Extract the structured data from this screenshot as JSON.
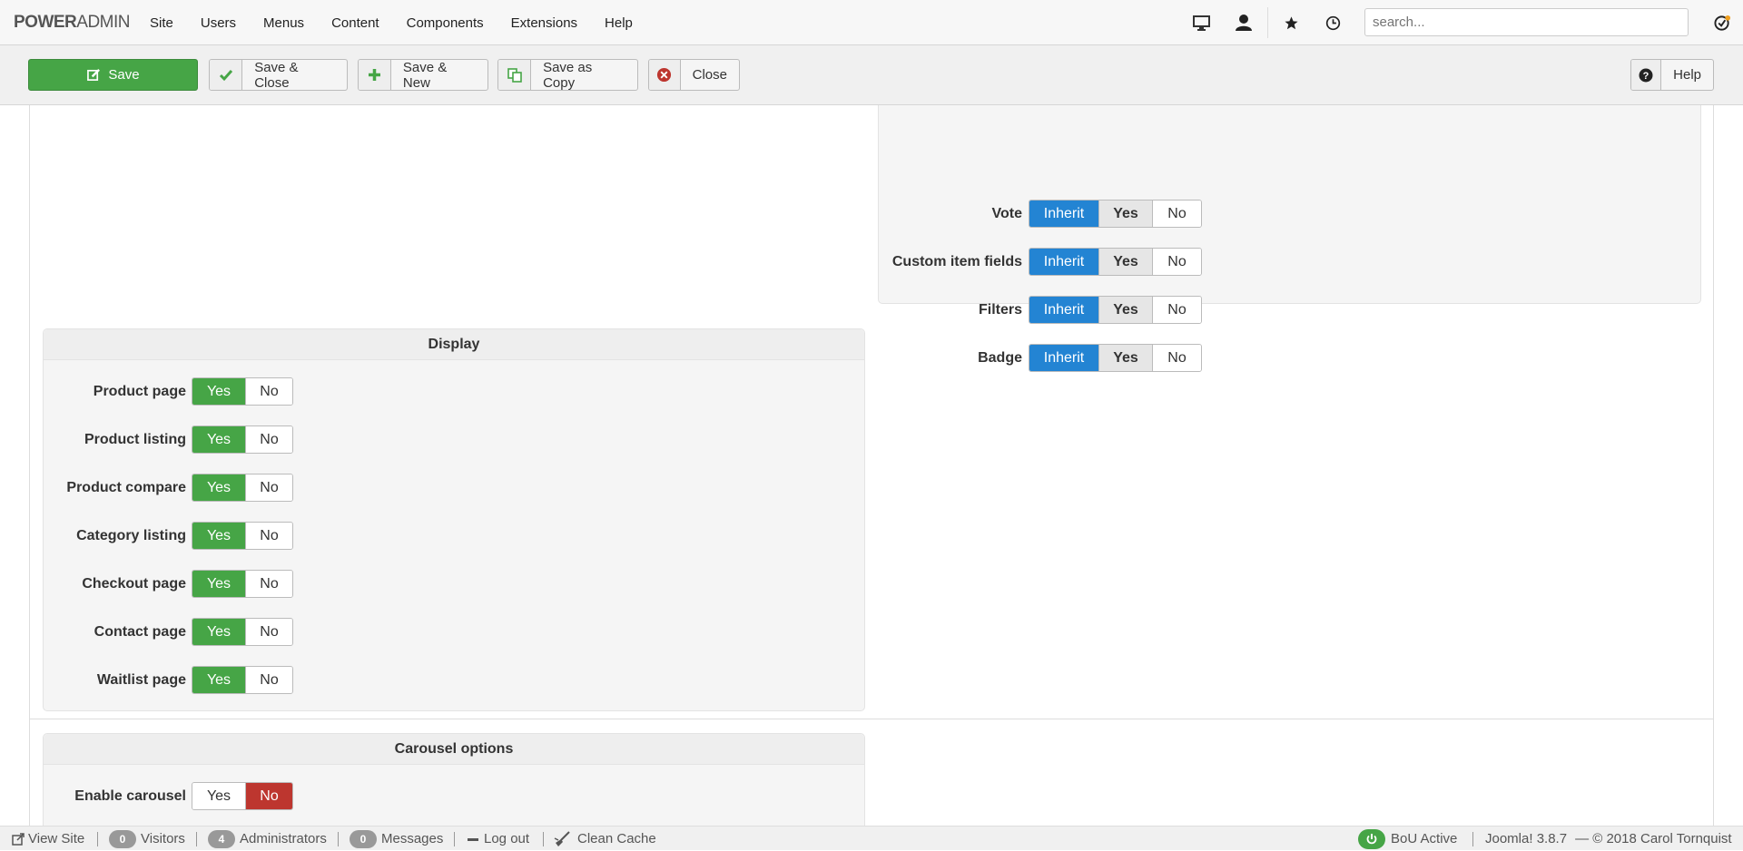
{
  "brand": {
    "power": "POWER",
    "admin": "ADMIN"
  },
  "menu": [
    "Site",
    "Users",
    "Menus",
    "Content",
    "Components",
    "Extensions",
    "Help"
  ],
  "search": {
    "placeholder": "search..."
  },
  "toolbar": {
    "save": "Save",
    "save_close": "Save & Close",
    "save_new": "Save & New",
    "save_copy": "Save as Copy",
    "close": "Close",
    "help": "Help"
  },
  "options_top": {
    "labels": {
      "inherit": "Inherit",
      "yes": "Yes",
      "no": "No"
    },
    "rows": [
      "Vote",
      "Custom item fields",
      "Filters",
      "Badge"
    ]
  },
  "display": {
    "title": "Display",
    "labels": {
      "yes": "Yes",
      "no": "No"
    },
    "rows": [
      "Product page",
      "Product listing",
      "Product compare",
      "Category listing",
      "Checkout page",
      "Contact page",
      "Waitlist page"
    ]
  },
  "carousel": {
    "title": "Carousel options",
    "enable_label": "Enable carousel",
    "yes": "Yes",
    "no": "No",
    "selected": "No"
  },
  "status": {
    "view_site": "View Site",
    "visitors_count": "0",
    "visitors": "Visitors",
    "admins_count": "4",
    "admins": "Administrators",
    "messages_count": "0",
    "messages": "Messages",
    "logout": "Log out",
    "clean_cache": "Clean Cache",
    "bou": "BoU Active",
    "version": "Joomla! 3.8.7",
    "copyright": "— © 2018 Carol Tornquist"
  },
  "colors": {
    "accent_blue": "#2384d3",
    "success_green": "#46a546",
    "danger_red": "#bd362f"
  }
}
